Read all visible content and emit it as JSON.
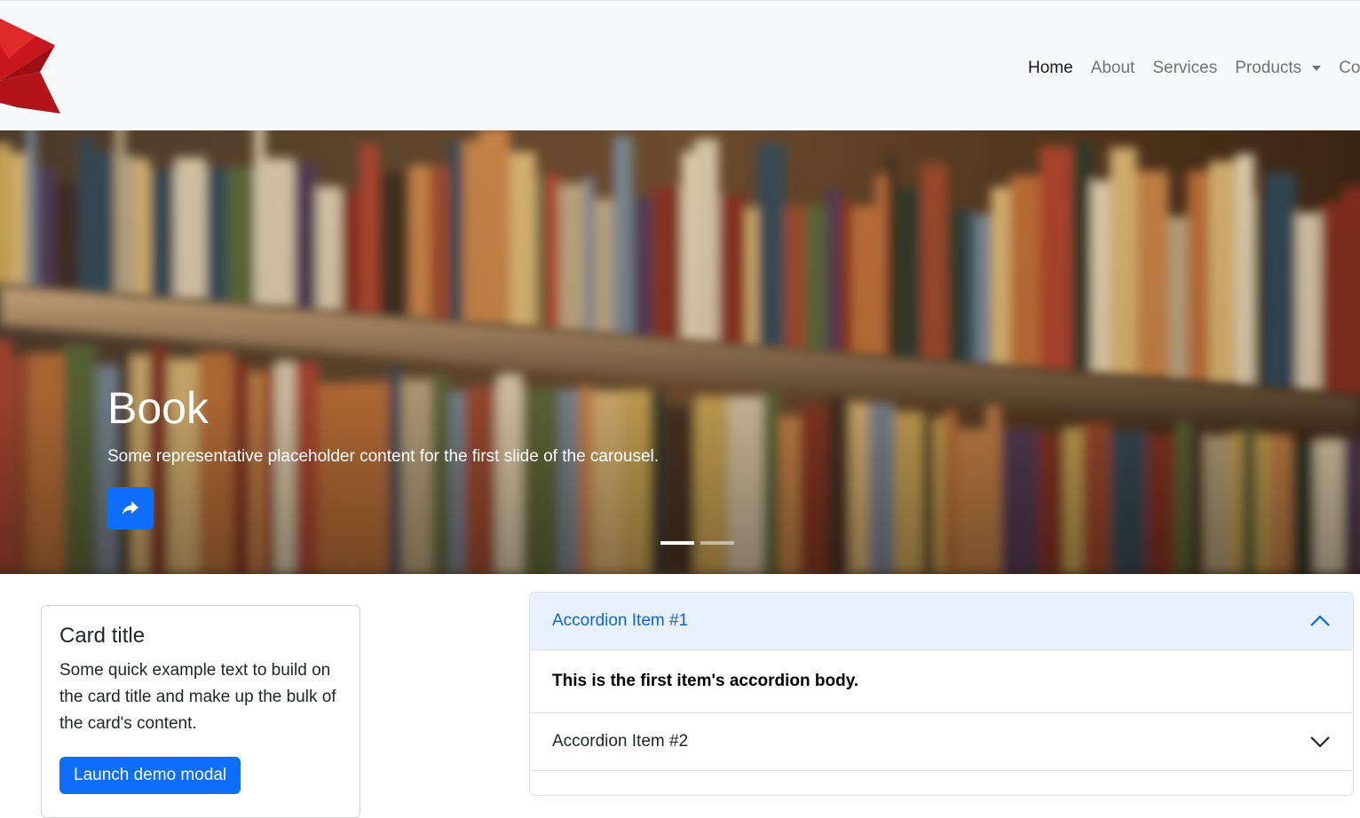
{
  "navbar": {
    "items": [
      {
        "label": "Home",
        "active": true
      },
      {
        "label": "About"
      },
      {
        "label": "Services"
      },
      {
        "label": "Products",
        "dropdown": true
      },
      {
        "label": "Co"
      }
    ]
  },
  "carousel": {
    "title": "Book",
    "text": "Some representative placeholder content for the first slide of the carousel.",
    "button_icon": "share-icon",
    "active_slide": 1,
    "slide_count": 2
  },
  "card": {
    "title": "Card title",
    "text": "Some quick example text to build on the card title and make up the bulk of the card's content.",
    "button_label": "Launch demo modal"
  },
  "accordion": {
    "items": [
      {
        "title": "Accordion Item #1",
        "body": "This is the first item's accordion body.",
        "open": true
      },
      {
        "title": "Accordion Item #2",
        "open": false
      }
    ]
  },
  "colors": {
    "primary": "#0d6efd",
    "navbar_bg": "#f8f9fa",
    "accordion_active_bg": "#e7f1ff",
    "accordion_active_text": "#0c63e4",
    "logo_red": "#c8161d"
  }
}
